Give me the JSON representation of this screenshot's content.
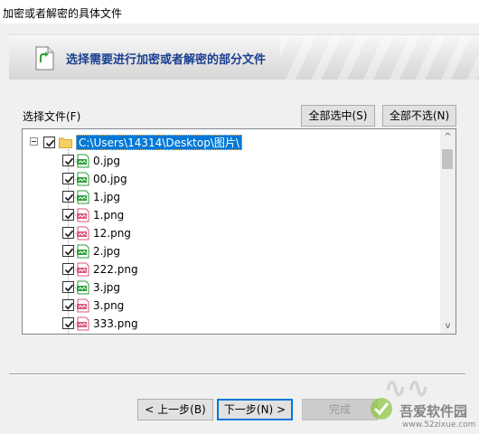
{
  "window": {
    "title": "加密或者解密的具体文件"
  },
  "banner": {
    "heading": "选择需要进行加密或者解密的部分文件",
    "icon": "document-arrow-icon"
  },
  "file_select": {
    "label": "选择文件(F)",
    "select_all_label": "全部选中(S)",
    "select_none_label": "全部不选(N)"
  },
  "tree": {
    "root": {
      "path": "C:\\Users\\14314\\Desktop\\图片\\",
      "checked": true,
      "expanded": true
    },
    "files": [
      {
        "name": "0.jpg",
        "type": "jpg",
        "checked": true
      },
      {
        "name": "00.jpg",
        "type": "jpg",
        "checked": true
      },
      {
        "name": "1.jpg",
        "type": "jpg",
        "checked": true
      },
      {
        "name": "1.png",
        "type": "png",
        "checked": true
      },
      {
        "name": "12.png",
        "type": "png",
        "checked": true
      },
      {
        "name": "2.jpg",
        "type": "jpg",
        "checked": true
      },
      {
        "name": "222.png",
        "type": "png",
        "checked": true
      },
      {
        "name": "3.jpg",
        "type": "jpg",
        "checked": true
      },
      {
        "name": "3.png",
        "type": "png",
        "checked": true
      },
      {
        "name": "333.png",
        "type": "png",
        "checked": true
      }
    ]
  },
  "nav": {
    "prev_label": "< 上一步(B)",
    "next_label": "下一步(N) >",
    "finish_label": "完成"
  },
  "watermark": {
    "brand": "吾爱软件园",
    "url": "www.52zixue.com"
  },
  "colors": {
    "banner_text": "#1a3f8f",
    "selection": "#0078d7",
    "jpg_icon": "#2e9e3a",
    "png_icon": "#d9577a"
  }
}
